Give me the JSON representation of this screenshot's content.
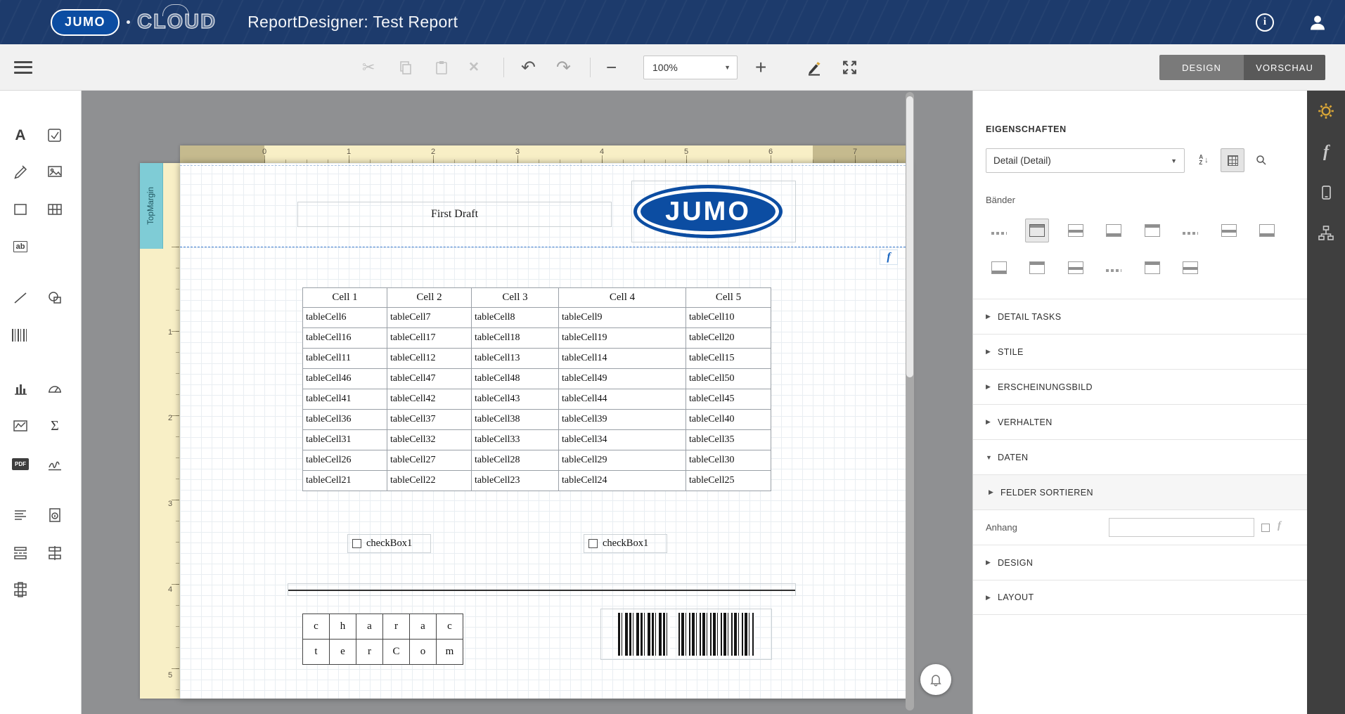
{
  "header": {
    "logo": "JUMO",
    "cloud": "CLOUD",
    "title": "ReportDesigner: Test Report"
  },
  "toolbar": {
    "zoom": "100%",
    "design": "DESIGN",
    "preview": "VORSCHAU"
  },
  "glyphs": {
    "info": "i",
    "cut": "✂",
    "delete": "✕",
    "undo": "↶",
    "redo": "↷",
    "minus": "−",
    "plus": "+",
    "caret_down": "▼",
    "arrow_collapsed": "▶",
    "arrow_expanded": "▼",
    "fx": "f",
    "sum": "Σ",
    "label_tool": "A",
    "charcomb_tool": "ab",
    "pdf_tool": "PDF",
    "sort_a": "A",
    "sort_z": "Z",
    "sort_arrow": "↓"
  },
  "designer": {
    "h_ruler": [
      "0",
      "1",
      "2",
      "3",
      "4",
      "5",
      "6",
      "7"
    ],
    "v_ruler": [
      "1",
      "2",
      "3",
      "4",
      "5"
    ],
    "top_margin_band": "TopMargin",
    "fx_badge": "f"
  },
  "report": {
    "title_box": "First Draft",
    "logo_text": "JUMO",
    "table_headers": [
      "Cell 1",
      "Cell 2",
      "Cell 3",
      "Cell 4",
      "Cell 5"
    ],
    "table_rows": [
      [
        "tableCell6",
        "tableCell7",
        "tableCell8",
        "tableCell9",
        "tableCell10"
      ],
      [
        "tableCell16",
        "tableCell17",
        "tableCell18",
        "tableCell19",
        "tableCell20"
      ],
      [
        "tableCell11",
        "tableCell12",
        "tableCell13",
        "tableCell14",
        "tableCell15"
      ],
      [
        "tableCell46",
        "tableCell47",
        "tableCell48",
        "tableCell49",
        "tableCell50"
      ],
      [
        "tableCell41",
        "tableCell42",
        "tableCell43",
        "tableCell44",
        "tableCell45"
      ],
      [
        "tableCell36",
        "tableCell37",
        "tableCell38",
        "tableCell39",
        "tableCell40"
      ],
      [
        "tableCell31",
        "tableCell32",
        "tableCell33",
        "tableCell34",
        "tableCell35"
      ],
      [
        "tableCell26",
        "tableCell27",
        "tableCell28",
        "tableCell29",
        "tableCell30"
      ],
      [
        "tableCell21",
        "tableCell22",
        "tableCell23",
        "tableCell24",
        "tableCell25"
      ]
    ],
    "checkbox_a": "checkBox1",
    "checkbox_b": "checkBox1",
    "comb_row1": [
      "c",
      "h",
      "a",
      "r",
      "a",
      "c"
    ],
    "comb_row2": [
      "t",
      "e",
      "r",
      "C",
      "o",
      "m"
    ]
  },
  "properties": {
    "title": "EIGENSCHAFTEN",
    "band_selector": "Detail (Detail)",
    "bands_label": "Bänder",
    "sections": {
      "detail_tasks": "DETAIL TASKS",
      "stile": "STILE",
      "erscheinungsbild": "ERSCHEINUNGSBILD",
      "verhalten": "VERHALTEN",
      "daten": "DATEN",
      "felder_sortieren": "FELDER SORTIEREN",
      "design": "DESIGN",
      "layout": "LAYOUT"
    },
    "anhang_label": "Anhang",
    "anhang_value": ""
  },
  "colors": {
    "brand_blue": "#0c4da2",
    "header_navy": "#1d3b6c",
    "band_teal": "#7fccd6",
    "accent_amber": "#d7a437",
    "band_line_blue": "#3c7bd0"
  }
}
